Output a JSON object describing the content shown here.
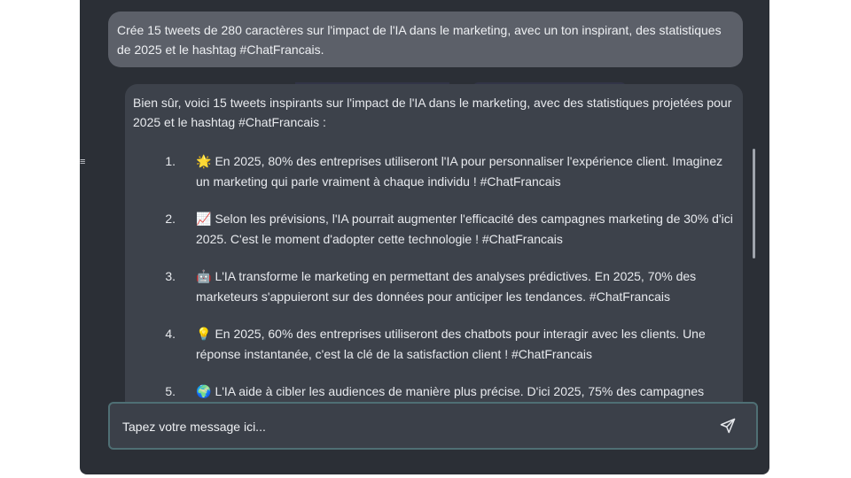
{
  "conversation": {
    "user_message": "Crée 15 tweets de 280 caractères sur l'impact de l'IA dans le marketing, avec un ton inspirant, des statistiques de 2025 et le hashtag #ChatFrancais.",
    "bot_intro": "Bien sûr, voici 15 tweets inspirants sur l'impact de l'IA dans le marketing, avec des statistiques projetées pour 2025 et le hashtag #ChatFrancais :",
    "tweets": [
      {
        "number": "1.",
        "emoji": "🌟",
        "text": "En 2025, 80% des entreprises utiliseront l'IA pour personnaliser l'expérience client. Imaginez un marketing qui parle vraiment à chaque individu ! #ChatFrancais"
      },
      {
        "number": "2.",
        "emoji": "📈",
        "text": "Selon les prévisions, l'IA pourrait augmenter l'efficacité des campagnes marketing de 30% d'ici 2025. C'est le moment d'adopter cette technologie ! #ChatFrancais"
      },
      {
        "number": "3.",
        "emoji": "🤖",
        "text": "L'IA transforme le marketing en permettant des analyses prédictives. En 2025, 70% des marketeurs s'appuieront sur des données pour anticiper les tendances. #ChatFrancais"
      },
      {
        "number": "4.",
        "emoji": "💡",
        "text": "En 2025, 60% des entreprises utiliseront des chatbots pour interagir avec les clients. Une réponse instantanée, c'est la clé de la satisfaction client ! #ChatFrancais"
      },
      {
        "number": "5.",
        "emoji": "🌍",
        "text": "L'IA aide à cibler les audiences de manière plus précise. D'ici 2025, 75% des campagnes"
      }
    ]
  },
  "composer": {
    "placeholder": "Tapez votre message ici...",
    "value": ""
  },
  "colors": {
    "app_background": "#2b2f36",
    "user_bubble": "#5c6069",
    "bot_bubble": "#3d424b",
    "composer_border": "#4f6f74"
  }
}
